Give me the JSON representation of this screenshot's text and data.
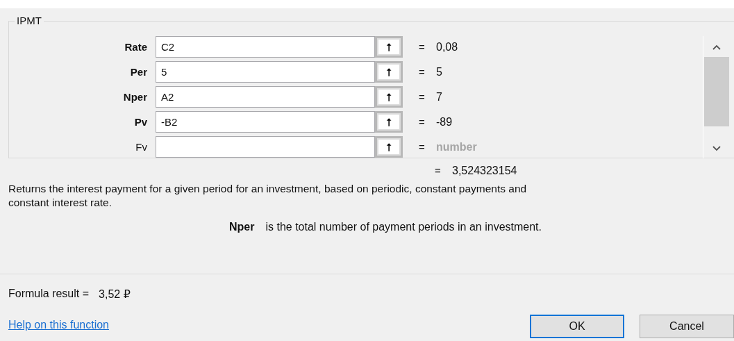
{
  "function_group": {
    "title": "IPMT",
    "arguments": [
      {
        "label": "Rate",
        "required": true,
        "value": "C2",
        "result": "0,08",
        "result_muted": false
      },
      {
        "label": "Per",
        "required": true,
        "value": "5",
        "result": "5",
        "result_muted": false
      },
      {
        "label": "Nper",
        "required": true,
        "value": "A2",
        "result": "7",
        "result_muted": false
      },
      {
        "label": "Pv",
        "required": true,
        "value": "-B2",
        "result": "-89",
        "result_muted": false
      },
      {
        "label": "Fv",
        "required": false,
        "result": "number",
        "result_muted": true
      }
    ],
    "collapse_button_glyph": "⭡"
  },
  "equals_sign": "=",
  "function_result": "3,524323154",
  "description": "Returns the interest payment for a given period for an investment, based on periodic, constant payments and\nconstant interest rate.",
  "argument_help": {
    "name": "Nper",
    "text": "is the total number of payment periods in an investment."
  },
  "formula_result": {
    "label": "Formula result =",
    "value": "3,52 ₽"
  },
  "help_link": "Help on this function",
  "buttons": [
    {
      "label": "OK",
      "default": true
    },
    {
      "label": "Cancel",
      "default": false
    }
  ]
}
